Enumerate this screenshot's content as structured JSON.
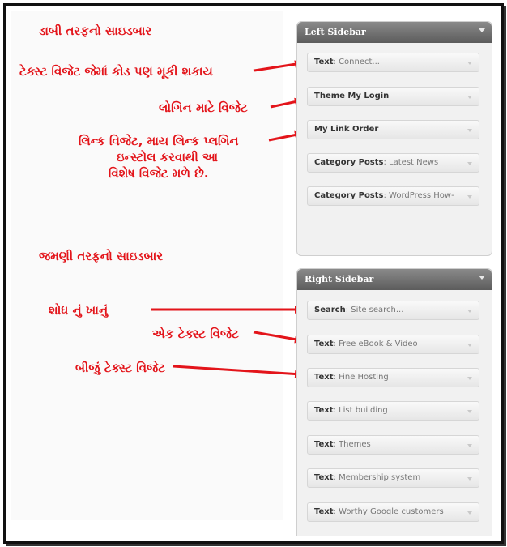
{
  "annotations": {
    "left_sidebar_title": "ડાબી તરફનો સાઇડબાર",
    "text_widget_note": "ટેક્સ્ટ વિજેટ જેમાં કોડ પણ મૂકી શકાય",
    "login_widget_note": "લોગિન માટે વિજેટ",
    "link_widget_note_1": "લિન્ક વિજેટ, માય લિન્ક પ્લગિન",
    "link_widget_note_2": "ઇન્સ્ટોલ કરવાથી આ",
    "link_widget_note_3": "વિશેષ વિજેટ મળે છે.",
    "right_sidebar_title": "જમણી તરફનો સાઇડબાર",
    "search_note": "શોધ નું ખાનું",
    "one_text_widget_note": "એક ટેક્સ્ટ વિજેટ",
    "second_text_widget_note": "બીજું ટેક્સ્ટ વિજેટ"
  },
  "left_sidebar": {
    "title": "Left Sidebar",
    "widgets": [
      {
        "name": "Text",
        "sub": ": Connect..."
      },
      {
        "name": "Theme My Login",
        "sub": ""
      },
      {
        "name": "My Link Order",
        "sub": ""
      },
      {
        "name": "Category Posts",
        "sub": ": Latest News"
      },
      {
        "name": "Category Posts",
        "sub": ": WordPress How-"
      }
    ]
  },
  "right_sidebar": {
    "title": "Right Sidebar",
    "widgets": [
      {
        "name": "Search",
        "sub": ": Site search..."
      },
      {
        "name": "Text",
        "sub": ": Free eBook & Video"
      },
      {
        "name": "Text",
        "sub": ": Fine Hosting"
      },
      {
        "name": "Text",
        "sub": ": List building"
      },
      {
        "name": "Text",
        "sub": ": Themes"
      },
      {
        "name": "Text",
        "sub": ": Membership system"
      },
      {
        "name": "Text",
        "sub": ": Worthy Google customers"
      }
    ]
  },
  "colors": {
    "annotation": "#e3141a",
    "header": "#6b6b6b"
  }
}
